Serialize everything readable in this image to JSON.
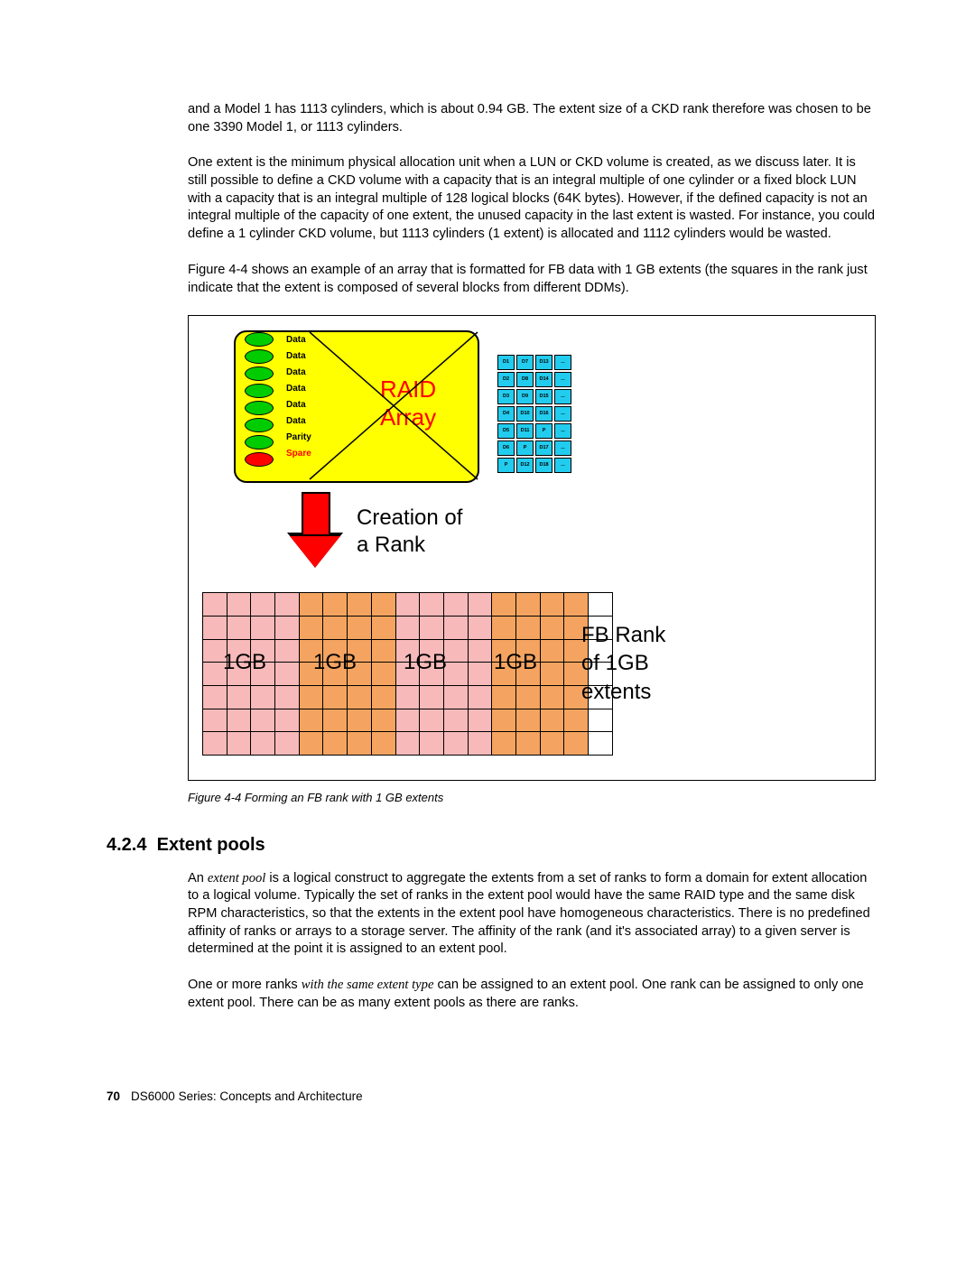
{
  "para1": "and a Model 1 has 1113 cylinders, which is about 0.94 GB. The extent size of a CKD rank therefore was chosen to be one 3390 Model 1, or 1113 cylinders.",
  "para2": "One extent is the minimum physical allocation unit when a LUN or CKD volume is created, as we discuss later. It is still possible to define a CKD volume with a capacity that is an integral multiple of one cylinder or a fixed block LUN with a capacity that is an integral multiple of 128 logical blocks (64K bytes). However, if the defined capacity is not an integral multiple of the capacity of one extent, the unused capacity in the last extent is wasted. For instance, you could define a 1 cylinder CKD volume, but 1113 cylinders (1 extent) is allocated and 1112 cylinders would be wasted.",
  "para3": "Figure 4-4 shows an example of an array that is formatted for FB data with 1 GB extents (the squares in the rank just indicate that the extent is composed of several blocks from different DDMs).",
  "fig": {
    "raid_line1": "RAID",
    "raid_line2": "Array",
    "disk_labels": [
      "Data",
      "Data",
      "Data",
      "Data",
      "Data",
      "Data",
      "Parity",
      "Spare"
    ],
    "arrow_text": "Creation of\na Rank",
    "gb": "1GB",
    "fb_text": "FB Rank\nof 1GB\nextents",
    "small_grid": [
      [
        "D1",
        "D7",
        "D13",
        "..."
      ],
      [
        "D2",
        "D8",
        "D14",
        "..."
      ],
      [
        "D3",
        "D9",
        "D15",
        "..."
      ],
      [
        "D4",
        "D10",
        "D16",
        "..."
      ],
      [
        "D5",
        "D11",
        "P",
        "..."
      ],
      [
        "D6",
        "P",
        "D17",
        "..."
      ],
      [
        "P",
        "D12",
        "D18",
        "..."
      ]
    ]
  },
  "caption": "Figure 4-4   Forming an FB rank with 1 GB extents",
  "section_num": "4.2.4",
  "section_title": "Extent pools",
  "para4a": "An ",
  "para4b": "extent pool",
  "para4c": " is a logical construct to aggregate the extents from a set of ranks to form a domain for extent allocation to a logical volume. Typically the set of ranks in the extent pool would have the same RAID type and the same disk RPM characteristics, so that the extents in the extent pool have homogeneous characteristics. There is no predefined affinity of ranks or arrays to a storage server. The affinity of the rank (and it's associated array) to a given server is determined at the point it is assigned to an extent pool.",
  "para5a": "One or more ranks ",
  "para5b": "with the same extent type",
  "para5c": " can be assigned to an extent pool. One rank can be assigned to only one extent pool. There can be as many extent pools as there are ranks.",
  "footer_page": "70",
  "footer_title": "DS6000 Series: Concepts and Architecture"
}
